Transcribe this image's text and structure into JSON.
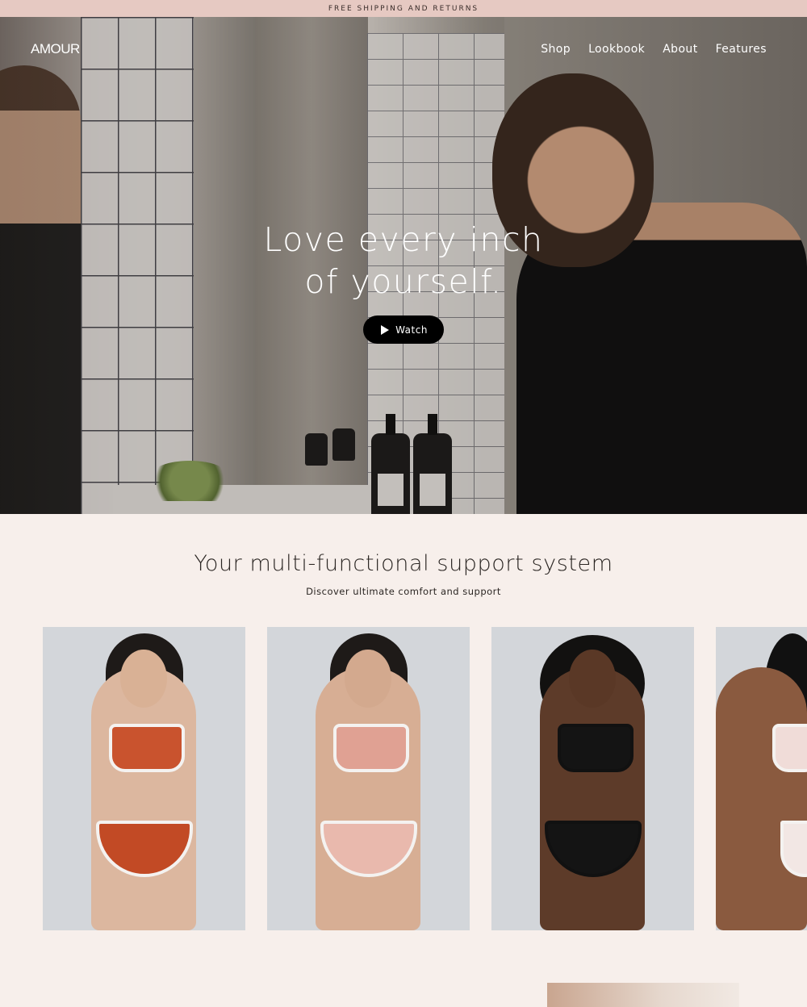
{
  "announcement": "FREE SHIPPING AND RETURNS",
  "brand": "AMOUR",
  "nav": {
    "items": [
      "Shop",
      "Lookbook",
      "About",
      "Features"
    ]
  },
  "hero": {
    "headline_line1": "Love every inch",
    "headline_line2": "of yourself.",
    "watch_label": "Watch",
    "play_icon": "play-icon"
  },
  "section": {
    "title": "Your multi-functional support system",
    "subtitle": "Discover ultimate comfort and support"
  },
  "products": [
    {
      "top_color": "#c9532e",
      "bottom_color": "#c24a25",
      "skin": "#dcb79f"
    },
    {
      "top_color": "#e0a193",
      "bottom_color": "#e9b9ad",
      "skin": "#d7ae94"
    },
    {
      "top_color": "#141414",
      "bottom_color": "#141414",
      "skin": "#5d3b29"
    },
    {
      "top_color": "#f0dcd8",
      "bottom_color": "#f2e7e4",
      "skin": "#8a5a3f"
    }
  ],
  "colors": {
    "announcement_bg": "#e6c9c2",
    "page_bg": "#f7efeb",
    "button_bg": "#000000"
  }
}
